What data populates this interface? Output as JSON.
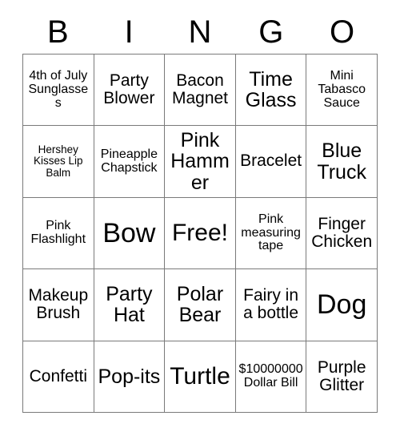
{
  "card": {
    "header_letters": [
      "B",
      "I",
      "N",
      "G",
      "O"
    ],
    "free_space_label": "Free!",
    "colors": {
      "background": "#ffffff",
      "text": "#000000",
      "grid_line": "#7a7a7a"
    },
    "grid": {
      "columns": 5,
      "rows": 5,
      "cells": [
        [
          "4th of July Sunglasses",
          "Party Blower",
          "Bacon Magnet",
          "Time Glass",
          "Mini Tabasco Sauce"
        ],
        [
          "Hershey Kisses Lip Balm",
          "Pineapple Chapstick",
          "Pink Hammer",
          "Bracelet",
          "Blue Truck"
        ],
        [
          "Pink Flashlight",
          "Bow",
          "Free!",
          "Pink measuring tape",
          "Finger Chicken"
        ],
        [
          "Makeup Brush",
          "Party Hat",
          "Polar Bear",
          "Fairy in a bottle",
          "Dog"
        ],
        [
          "Confetti",
          "Pop-its",
          "Turtle",
          "$10000000 Dollar Bill",
          "Purple Glitter"
        ]
      ]
    }
  }
}
